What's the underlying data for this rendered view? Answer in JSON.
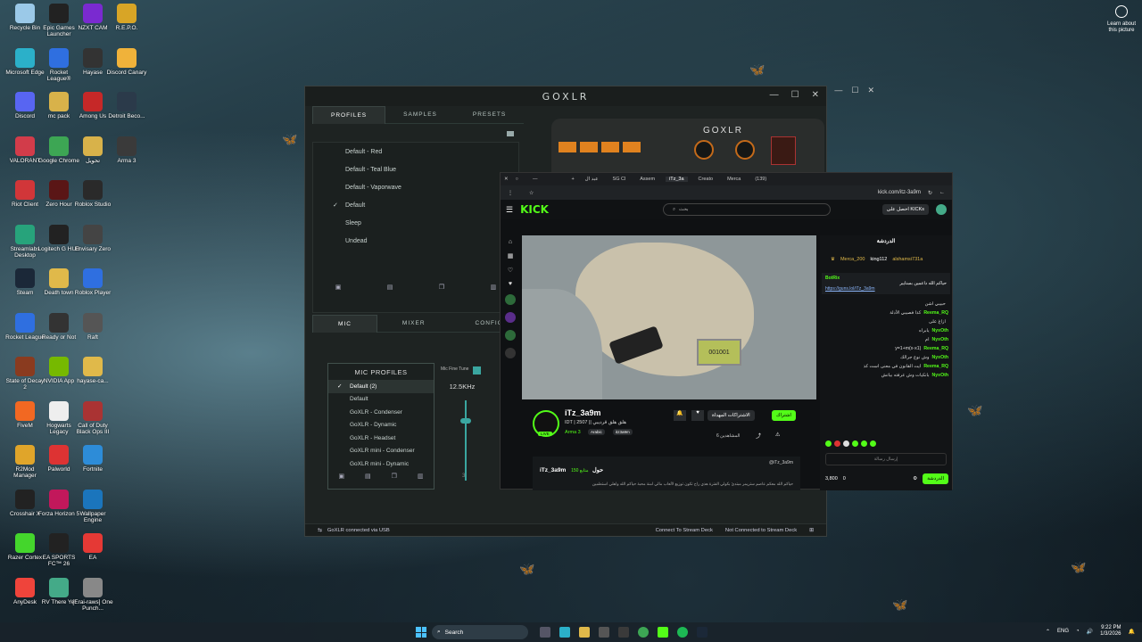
{
  "desktop": {
    "icons": [
      {
        "label": "Recycle Bin",
        "c": "#9bc9e8"
      },
      {
        "label": "Epic Games Launcher",
        "c": "#222"
      },
      {
        "label": "NZXT CAM",
        "c": "#7a2ad0"
      },
      {
        "label": "R.E.P.O.",
        "c": "#d8a526"
      },
      {
        "label": "Microsoft Edge",
        "c": "#2bb0c9"
      },
      {
        "label": "Rocket League®",
        "c": "#2f6fe0"
      },
      {
        "label": "Hayase",
        "c": "#333"
      },
      {
        "label": "Discord Canary",
        "c": "#f0b23a"
      },
      {
        "label": "Discord",
        "c": "#5865f2"
      },
      {
        "label": "mc pack",
        "c": "#d8b24a"
      },
      {
        "label": "Among Us",
        "c": "#c62828"
      },
      {
        "label": "Detroit Beco...",
        "c": "#2b3a4a"
      },
      {
        "label": "VALORANT",
        "c": "#d23c4a"
      },
      {
        "label": "Google Chrome",
        "c": "#3da654"
      },
      {
        "label": "تحويل",
        "c": "#d8b24a"
      },
      {
        "label": "Arma 3",
        "c": "#3a3a3a"
      },
      {
        "label": "Riot Client",
        "c": "#d13639"
      },
      {
        "label": "Zero Hour",
        "c": "#5a1616"
      },
      {
        "label": "Roblox Studio",
        "c": "#2a2a2a"
      },
      {
        "label": "",
        "c": "transparent"
      },
      {
        "label": "Streamlabs Desktop",
        "c": "#27a37b"
      },
      {
        "label": "Logitech G HUB",
        "c": "#222"
      },
      {
        "label": "Envisary Zero",
        "c": "#444"
      },
      {
        "label": "",
        "c": "transparent"
      },
      {
        "label": "Steam",
        "c": "#1b2838"
      },
      {
        "label": "Death town",
        "c": "#e0b94a"
      },
      {
        "label": "Roblox Player",
        "c": "#2f6fe0"
      },
      {
        "label": "",
        "c": "transparent"
      },
      {
        "label": "Rocket League",
        "c": "#2f6fe0"
      },
      {
        "label": "Ready or Not",
        "c": "#333"
      },
      {
        "label": "Raft",
        "c": "#555"
      },
      {
        "label": "",
        "c": "transparent"
      },
      {
        "label": "State of Decay 2",
        "c": "#8a3b1f"
      },
      {
        "label": "NVIDIA App",
        "c": "#76b900"
      },
      {
        "label": "hayase-ca...",
        "c": "#e0b94a"
      },
      {
        "label": "",
        "c": "transparent"
      },
      {
        "label": "FiveM",
        "c": "#f26822"
      },
      {
        "label": "Hogwarts Legacy",
        "c": "#eee"
      },
      {
        "label": "Call of Duty Black Ops III",
        "c": "#a33"
      },
      {
        "label": "",
        "c": "transparent"
      },
      {
        "label": "R2Mod Manager",
        "c": "#e0a52a"
      },
      {
        "label": "Palworld",
        "c": "#d33"
      },
      {
        "label": "Fortnite",
        "c": "#2d8cd8"
      },
      {
        "label": "",
        "c": "transparent"
      },
      {
        "label": "Crosshair X",
        "c": "#222"
      },
      {
        "label": "Forza Horizon 5",
        "c": "#c2185b"
      },
      {
        "label": "Wallpaper Engine",
        "c": "#1b75bc"
      },
      {
        "label": "",
        "c": "transparent"
      },
      {
        "label": "Razer Cortex",
        "c": "#44d62c"
      },
      {
        "label": "EA SPORTS FC™ 26",
        "c": "#222"
      },
      {
        "label": "EA",
        "c": "#e53935"
      },
      {
        "label": "",
        "c": "transparent"
      },
      {
        "label": "AnyDesk",
        "c": "#ef443b"
      },
      {
        "label": "RV There Yet",
        "c": "#4a8"
      },
      {
        "label": "[Erai-raws] One Punch...",
        "c": "#888"
      },
      {
        "label": "",
        "c": "transparent"
      }
    ],
    "learn": "Learn about this picture"
  },
  "goxlr": {
    "title": "GOXLR",
    "logo": "GOXLR",
    "tabs": [
      "PROFILES",
      "SAMPLES",
      "PRESETS"
    ],
    "profiles": [
      "Default - Red",
      "Default - Teal Blue",
      "Default - Vaporwave",
      "Default",
      "Sleep",
      "Undead"
    ],
    "lower_tabs": [
      "MIC",
      "MIXER",
      "CONFIGURE"
    ],
    "mic_profiles_title": "MIC PROFILES",
    "mic_profiles": [
      "Default (2)",
      "Default",
      "GoXLR - Condenser",
      "GoXLR - Dynamic",
      "GoXLR - Headset",
      "GoXLR mini - Condenser",
      "GoXLR mini - Dynamic"
    ],
    "fine_tune_label": "Mic Fine Tune",
    "freq": "12.5KHz",
    "slider_value": "3",
    "status_left": "GoXLR connected via USB",
    "status_mid": "Connect To Stream Deck",
    "status_right": "Not Connected to Stream Deck"
  },
  "browser": {
    "tabs": [
      "عبد ال",
      "SG Cl",
      "Assem",
      "iTz_3a",
      "Creato",
      "Merca",
      "(139)"
    ],
    "url": "kick.com/itz-3a9m",
    "search_placeholder": "بحث",
    "get_kicks": "احصل على KICKs",
    "map_counter": "001001",
    "channel_name": "iTz_3a9m",
    "stream_title": "IDT | 2507 || هلق هلق قرديبي",
    "game": "Arma 3",
    "tags": [
      "Arabic",
      "itz3a9m"
    ],
    "live": "LIVE",
    "viewers": "المشاهدين 6",
    "subscribe": "اشتراك",
    "gift": "الاشتراكات المهداة",
    "about_name": "iTz_3a9m حول",
    "followers": "متابع 150",
    "x_handle": "@iTz_3a9m",
    "about_text": "حياكم الله معكم عاصم ستريمر مبتدئ بكولي الفترة هذي راح تكون توزيع لألعاب مالي أمنة محبة حياكم الله وأهلي أستطمين"
  },
  "chat": {
    "title": "الدردشة",
    "top": [
      {
        "name": "Merca_200",
        "count": "13"
      },
      {
        "name": "king112",
        "count": "2"
      },
      {
        "name": "alshamsi731a",
        "count": "2"
      }
    ],
    "pinned_user": "BotRix",
    "pinned_msg": "حياكم الله داعمين بسنايبر",
    "pinned_link": "https://guns.lol/iTz_3a9m",
    "messages": [
      {
        "name": "",
        "text": "حبيبي اشن"
      },
      {
        "name": "Reema_RQ",
        "text": "كذا فصيبي الأدلة"
      },
      {
        "name": "",
        "text": "ازاغ على"
      },
      {
        "name": "NyxOth",
        "text": "يابراه"
      },
      {
        "name": "NyxOth",
        "text": "ام"
      },
      {
        "name": "Reema_RQ",
        "text": "y=1+m(x-x1)"
      },
      {
        "name": "NyxOth",
        "text": "وش نوع جرالك"
      },
      {
        "name": "Reema_RQ",
        "text": "ايت القانون في معنى است كذ"
      },
      {
        "name": "NyxOth",
        "text": "بانكيات وش عرفته بياتش"
      }
    ],
    "send_placeholder": "إرسال رسالة",
    "kicks": "3,800",
    "points": "0",
    "chat_btn": "الدردشة"
  },
  "taskbar": {
    "search": "Search",
    "lang": "ENG",
    "time": "9:22 PM",
    "date": "1/3/2026"
  }
}
